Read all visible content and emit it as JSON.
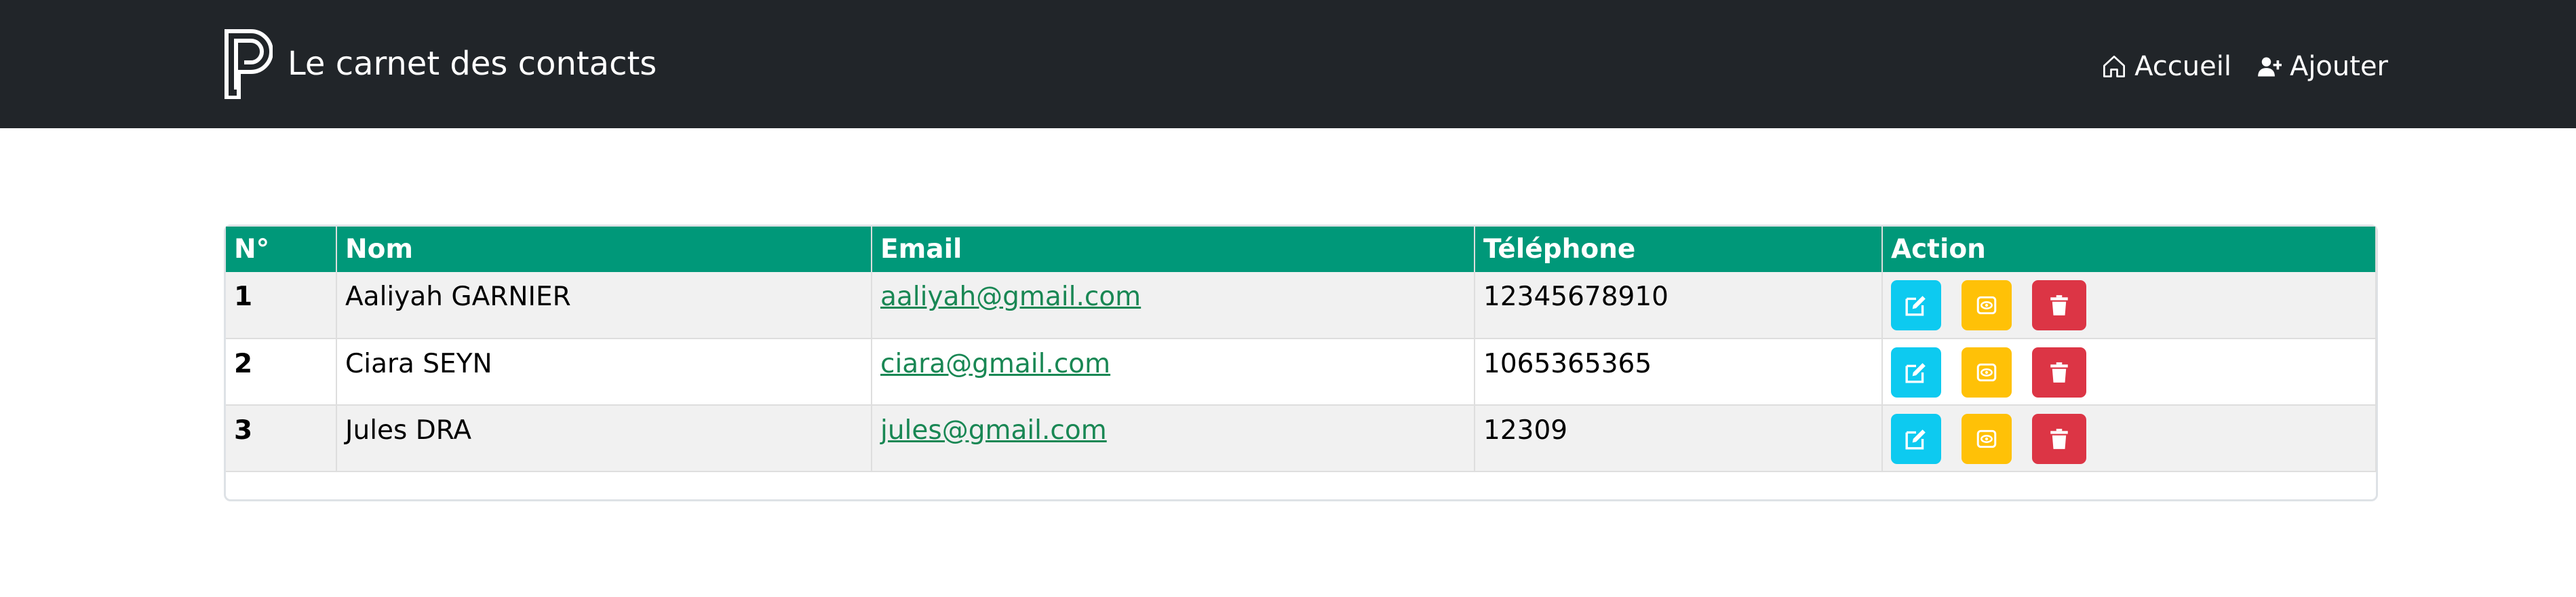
{
  "navbar": {
    "brand_title": "Le carnet des contacts",
    "logo_icon": "letter-p-logo",
    "links": [
      {
        "label": "Accueil",
        "icon": "house-icon"
      },
      {
        "label": "Ajouter",
        "icon": "person-plus-icon"
      }
    ],
    "background": "#212529"
  },
  "table": {
    "header_color": "#009879",
    "link_color": "#198754",
    "columns": [
      "N°",
      "Nom",
      "Email",
      "Téléphone",
      "Action"
    ],
    "rows": [
      {
        "num": "1",
        "nom": "Aaliyah GARNIER",
        "email": "aaliyah@gmail.com",
        "telephone": "12345678910"
      },
      {
        "num": "2",
        "nom": "Ciara SEYN",
        "email": "ciara@gmail.com",
        "telephone": "1065365365"
      },
      {
        "num": "3",
        "nom": "Jules DRA",
        "email": "jules@gmail.com",
        "telephone": "12309"
      }
    ],
    "actions": [
      {
        "icon": "edit-icon",
        "color": "#0dcaf0"
      },
      {
        "icon": "view-icon",
        "color": "#ffc107"
      },
      {
        "icon": "trash-icon",
        "color": "#dc3545"
      }
    ]
  }
}
